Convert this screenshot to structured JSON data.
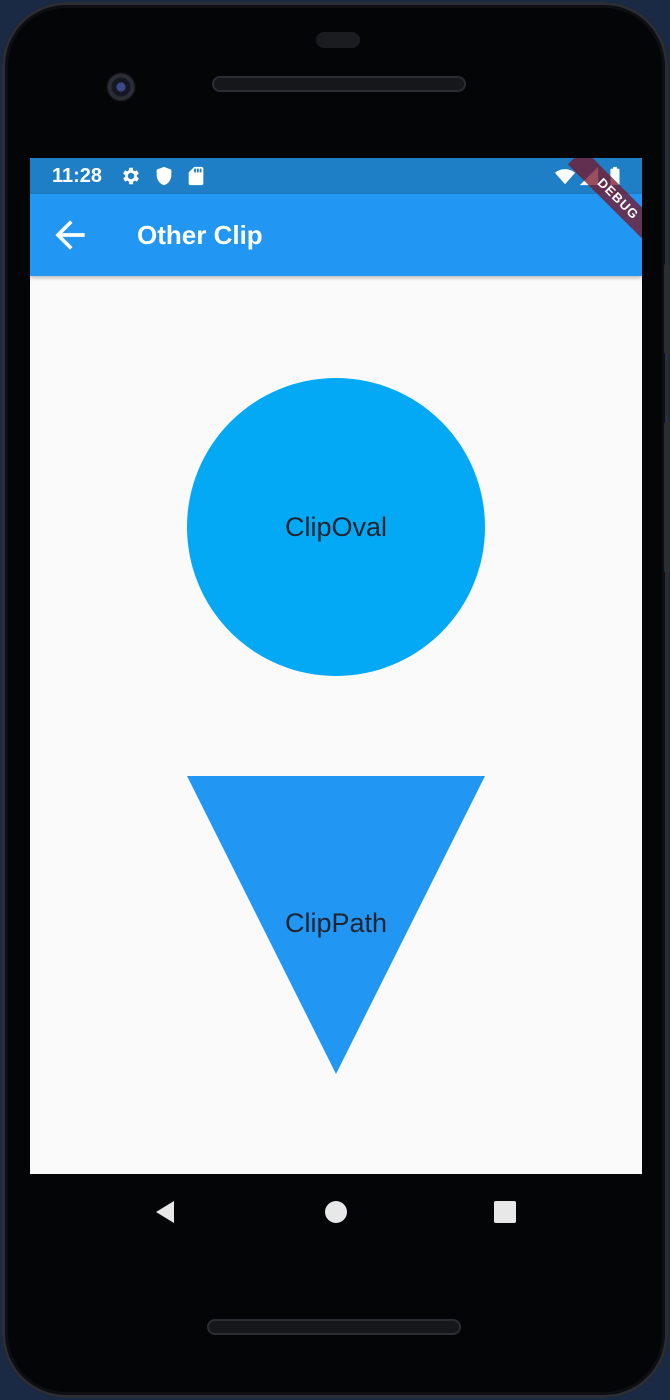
{
  "status_bar": {
    "time": "11:28",
    "left_icons": [
      "settings-icon",
      "shield-icon",
      "sd-card-icon"
    ],
    "right_icons": [
      "wifi-icon",
      "cell-signal-icon",
      "battery-icon"
    ]
  },
  "app_bar": {
    "title": "Other Clip",
    "back_icon": "arrow-left-icon"
  },
  "debug_banner": {
    "label": "DEBUG"
  },
  "content": {
    "clip_oval": {
      "label": "ClipOval",
      "color": "#03a9f4"
    },
    "clip_path": {
      "label": "ClipPath",
      "color": "#2196f3"
    }
  },
  "nav_bar": {
    "buttons": [
      "back-triangle-icon",
      "home-circle-icon",
      "recents-square-icon"
    ]
  },
  "colors": {
    "app_bar": "#2196f3",
    "status_bar": "#1e7fc7",
    "background": "#fafafa"
  }
}
